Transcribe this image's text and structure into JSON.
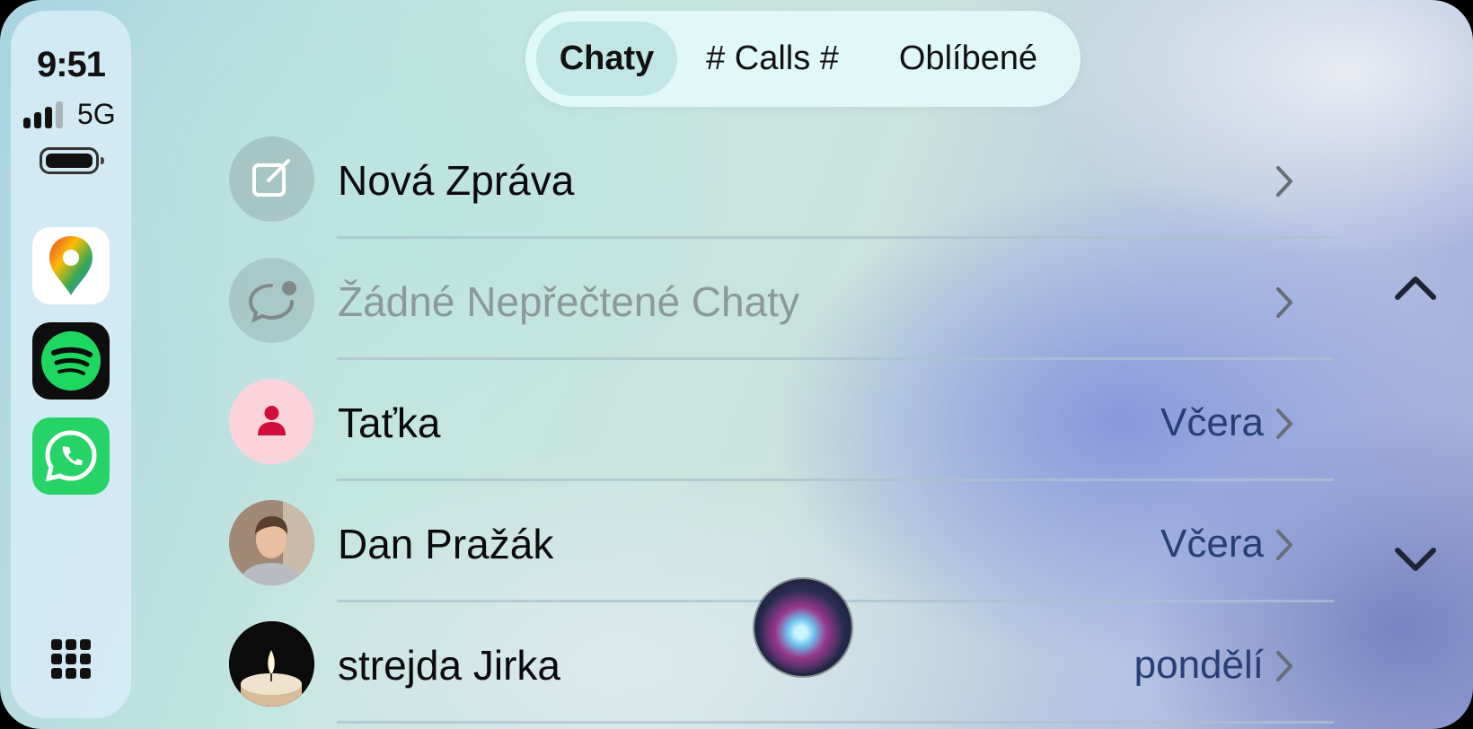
{
  "status": {
    "time": "9:51",
    "network": "5G",
    "battery_level": 1.0
  },
  "dock": {
    "apps": [
      {
        "name": "google-maps-app-icon"
      },
      {
        "name": "spotify-app-icon"
      },
      {
        "name": "whatsapp-app-icon"
      }
    ],
    "app_grid_icon": "grid-icon"
  },
  "tabs": [
    {
      "label": "Chaty",
      "active": true
    },
    {
      "label": "# Calls #",
      "active": false
    },
    {
      "label": "Oblíbené",
      "active": false
    }
  ],
  "list": [
    {
      "title": "Nová Zpráva",
      "meta": "",
      "icon": "compose-icon"
    },
    {
      "title": "Žádné Nepřečtené Chaty",
      "meta": "",
      "icon": "unread-chat-icon",
      "disabled": true
    },
    {
      "title": "Taťka",
      "meta": "Včera",
      "icon": "person-icon"
    },
    {
      "title": "Dan Pražák",
      "meta": "Včera",
      "icon": "contact-photo"
    },
    {
      "title": "strejda Jirka",
      "meta": "pondělí",
      "icon": "candle-photo"
    }
  ],
  "colors": {
    "accent_red": "#d0103a",
    "meta_text": "#263f75",
    "whatsapp_green": "#25d366",
    "spotify_green": "#1ed760"
  }
}
